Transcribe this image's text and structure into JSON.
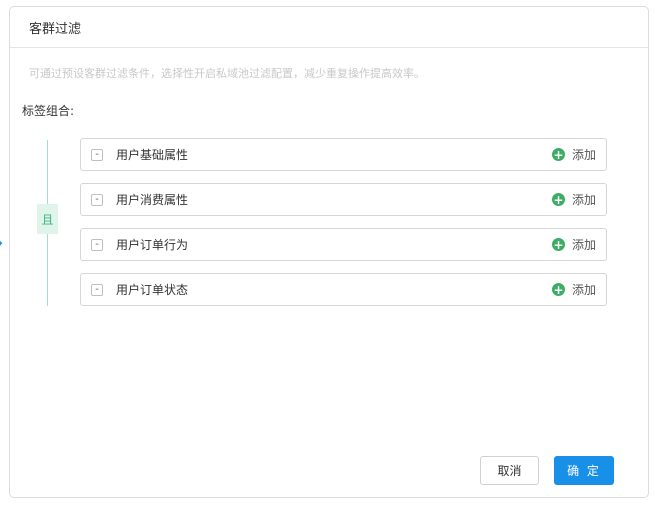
{
  "dialog": {
    "title": "客群过滤",
    "hint": "可通过预设客群过滤条件，选择性开启私域池过滤配置，减少重复操作提高效率。",
    "section_label": "标签组合:",
    "logic_badge": "且",
    "rows": [
      {
        "label": "用户基础属性",
        "collapse": "-",
        "add_label": "添加"
      },
      {
        "label": "用户消费属性",
        "collapse": "-",
        "add_label": "添加"
      },
      {
        "label": "用户订单行为",
        "collapse": "-",
        "add_label": "添加"
      },
      {
        "label": "用户订单状态",
        "collapse": "-",
        "add_label": "添加"
      }
    ],
    "buttons": {
      "cancel": "取消",
      "confirm": "确 定"
    }
  },
  "icons": {
    "add": "plus-circle-icon",
    "collapse": "minus-square-icon",
    "arrow": "arrow-right-icon"
  },
  "colors": {
    "primary": "#1890e8",
    "add_green": "#3cae63",
    "logic_green": "#3fb27f",
    "logic_bg": "#dff5ec"
  }
}
